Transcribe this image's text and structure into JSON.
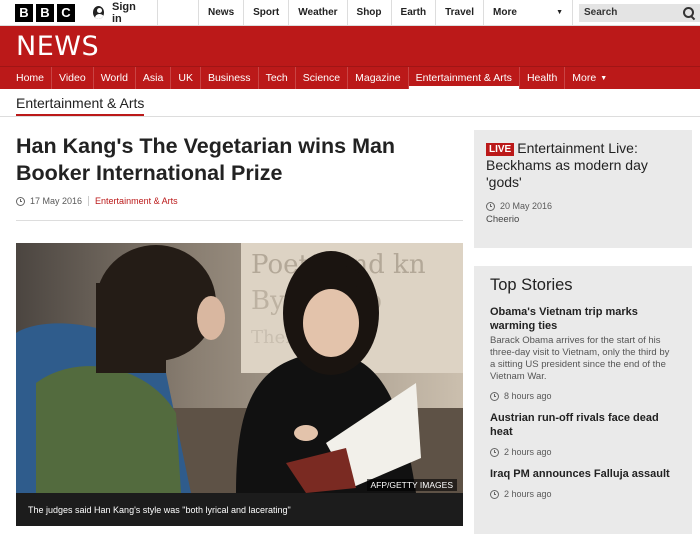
{
  "bbc": {
    "letters": [
      "B",
      "B",
      "C"
    ]
  },
  "topbar": {
    "signin": "Sign in",
    "nav": [
      "News",
      "Sport",
      "Weather",
      "Shop",
      "Earth",
      "Travel"
    ],
    "more": "More",
    "search_label": "Search"
  },
  "header": {
    "logo": "NEWS"
  },
  "sections": [
    "Home",
    "Video",
    "World",
    "Asia",
    "UK",
    "Business",
    "Tech",
    "Science",
    "Magazine",
    "Entertainment & Arts",
    "Health",
    "More"
  ],
  "active_section": "Entertainment & Arts",
  "page_section": "Entertainment & Arts",
  "article": {
    "headline": "Han Kang's The Vegetarian wins Man Booker International Prize",
    "date": "17 May 2016",
    "category": "Entertainment & Arts",
    "image_credit": "AFP/GETTY IMAGES",
    "caption": "The judges said Han Kang's style was \"both lyrical and lacerating\""
  },
  "live": {
    "badge": "LIVE",
    "title": "Entertainment Live: Beckhams as modern day 'gods'",
    "date": "20 May 2016",
    "sub": "Cheerio"
  },
  "top_stories": {
    "heading": "Top Stories",
    "items": [
      {
        "title": "Obama's Vietnam trip marks warming ties",
        "summary": "Barack Obama arrives for the start of his three-day visit to Vietnam, only the third by a sitting US president since the end of the Vietnam War.",
        "time": "8 hours ago"
      },
      {
        "title": "Austrian run-off rivals face dead heat",
        "summary": "",
        "time": "2 hours ago"
      },
      {
        "title": "Iraq PM announces Falluja assault",
        "summary": "",
        "time": "2 hours ago"
      }
    ]
  },
  "colors": {
    "brand_red": "#bb1919",
    "caption_bg": "#1c1c1c",
    "sidebar_bg": "#eaeaea"
  }
}
